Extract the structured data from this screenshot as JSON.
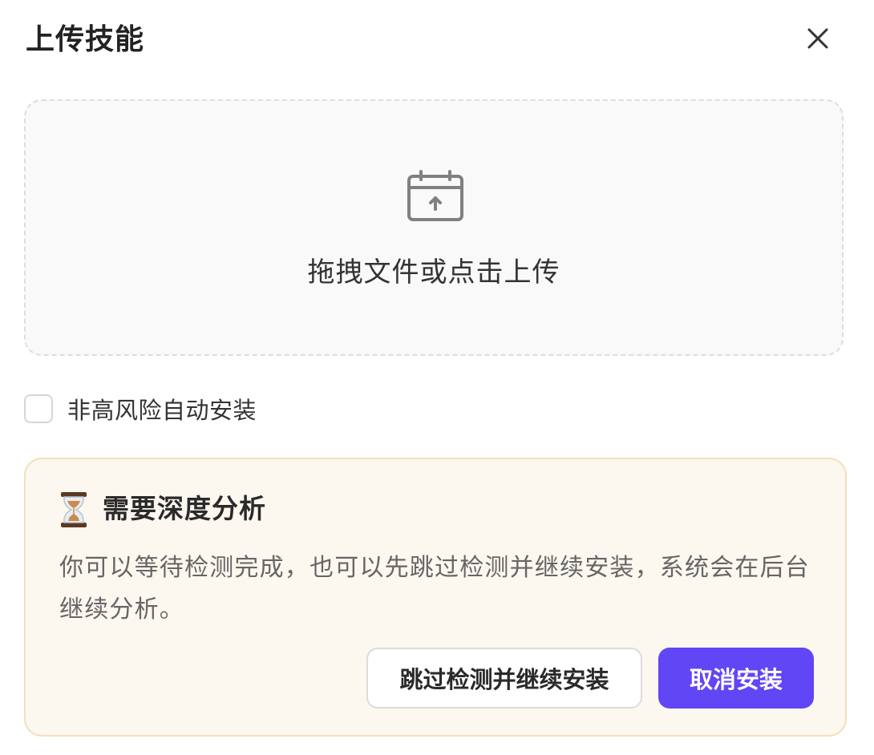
{
  "dialog": {
    "title": "上传技能"
  },
  "dropzone": {
    "icon": "upload-icon",
    "text": "拖拽文件或点击上传"
  },
  "auto_install": {
    "label": "非高风险自动安装",
    "checked": false
  },
  "notice": {
    "icon": "hourglass-icon",
    "title": "需要深度分析",
    "text": "你可以等待检测完成，也可以先跳过检测并继续安装，系统会在后台继续分析。",
    "skip_label": "跳过检测并继续安装",
    "cancel_label": "取消安装"
  },
  "colors": {
    "accent": "#6146f5",
    "notice_bg": "#fcf7ef",
    "notice_border": "#f3dfbb"
  }
}
